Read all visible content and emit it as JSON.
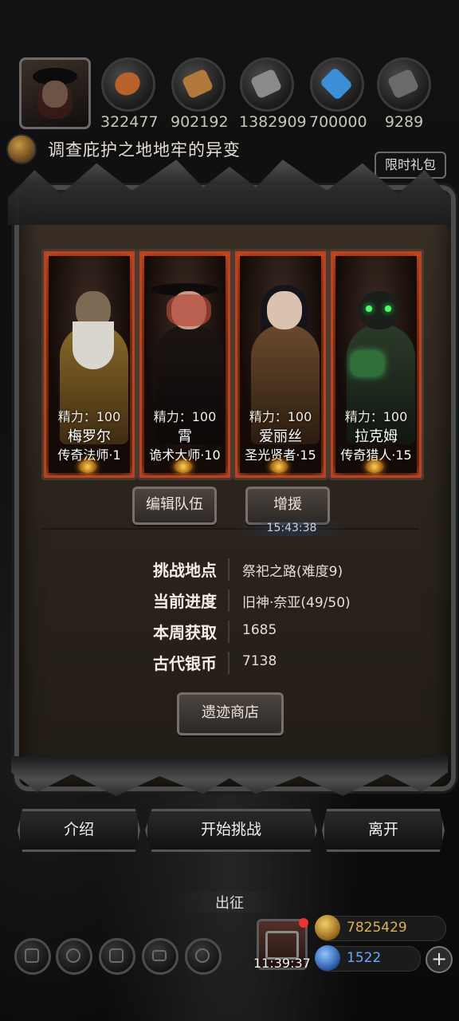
{
  "resources": [
    {
      "icon": "meat-icon",
      "value": "322477",
      "color": "#b8612a"
    },
    {
      "icon": "wood-icon",
      "value": "902192",
      "color": "#b27a3a"
    },
    {
      "icon": "iron-icon",
      "value": "1382909",
      "color": "#7a7a7a"
    },
    {
      "icon": "crystal-icon",
      "value": "700000",
      "color": "#3a8fd6"
    },
    {
      "icon": "stone-icon",
      "value": "9289",
      "color": "#6a6a6a"
    }
  ],
  "quest": {
    "text": "调查庇护之地地牢的异变"
  },
  "gift_tab": {
    "label": "限时礼包"
  },
  "heroes": [
    {
      "stamina": "精力：100",
      "name": "梅罗尔",
      "title": "传奇法师·1"
    },
    {
      "stamina": "精力：100",
      "name": "霄",
      "title": "诡术大师·10"
    },
    {
      "stamina": "精力：100",
      "name": "爱丽丝",
      "title": "圣光贤者·15"
    },
    {
      "stamina": "精力：100",
      "name": "拉克姆",
      "title": "传奇猎人·15"
    }
  ],
  "team_buttons": {
    "edit": "编辑队伍",
    "reinforce": "增援"
  },
  "timer": "15:43:38",
  "info": [
    {
      "label": "挑战地点",
      "value": "祭祀之路(难度9)"
    },
    {
      "label": "当前进度",
      "value": "旧神·奈亚(49/50)"
    },
    {
      "label": "本周获取",
      "value": "1685"
    },
    {
      "label": "古代银币",
      "value": "7138"
    }
  ],
  "shop_button": "遗迹商店",
  "actions": {
    "intro": "介绍",
    "start": "开始挑战",
    "leave": "离开"
  },
  "expedition_label": "出征",
  "bottom": {
    "clock": "11:39:37",
    "gold": "7825429",
    "gems": "1522",
    "plus": "+"
  },
  "colors": {
    "gold_text": "#d9b25a",
    "gem_text": "#6aa9ff",
    "card_glow": "#b7441e"
  }
}
